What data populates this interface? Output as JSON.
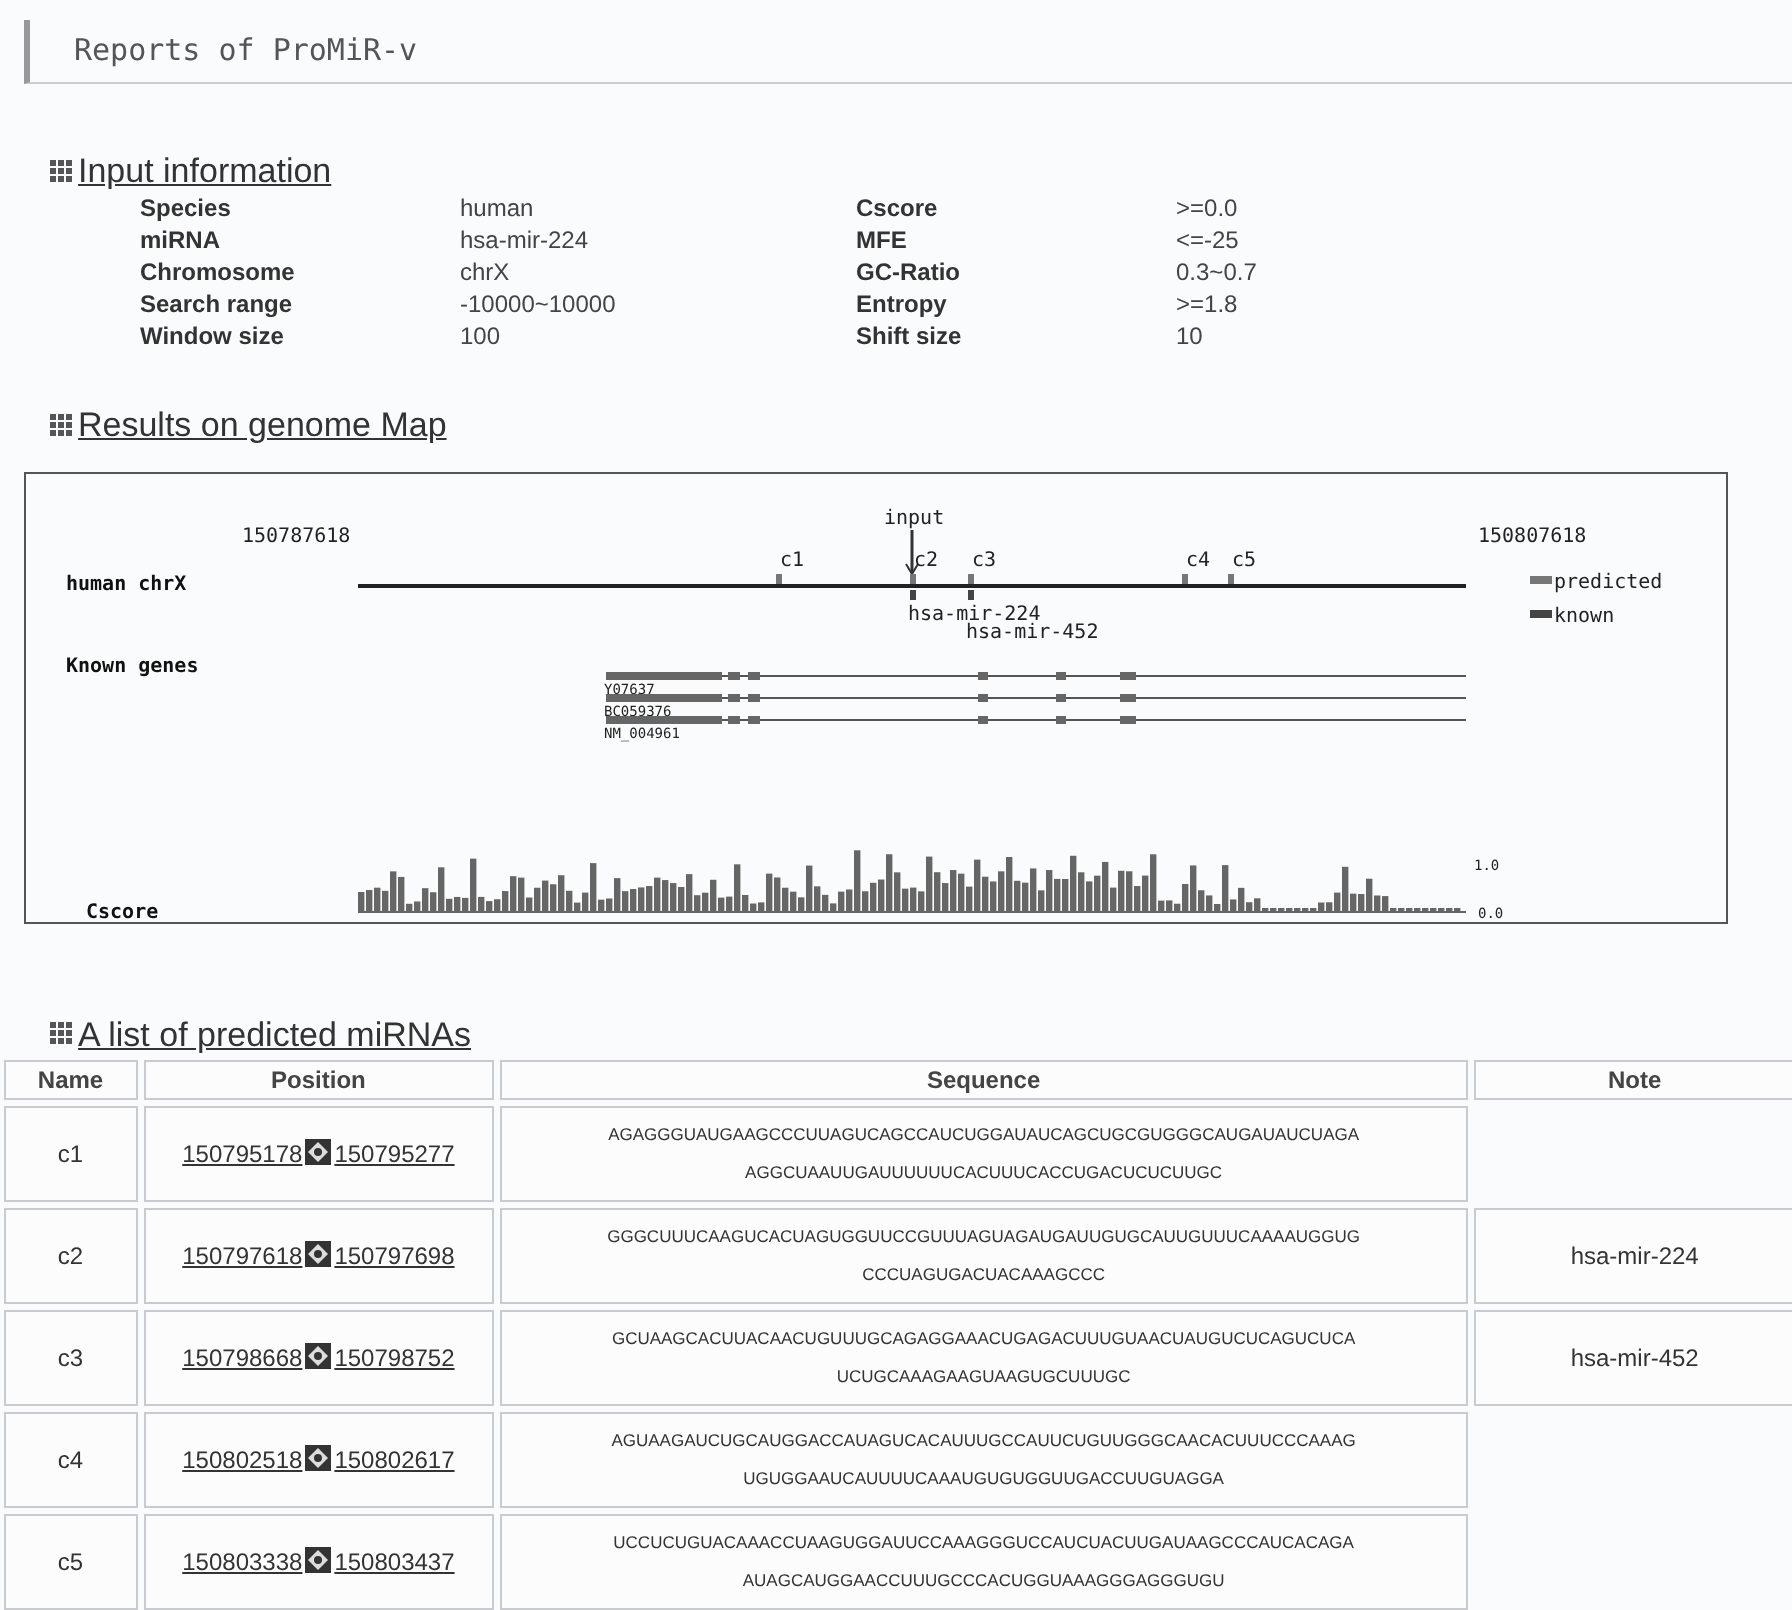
{
  "title": "Reports of ProMiR-v",
  "input_information": {
    "heading": "Input information",
    "left": [
      {
        "label": "Species",
        "value": "human"
      },
      {
        "label": "miRNA",
        "value": "hsa-mir-224"
      },
      {
        "label": "Chromosome",
        "value": "chrX"
      },
      {
        "label": "Search range",
        "value": "-10000~10000"
      },
      {
        "label": "Window size",
        "value": "100"
      }
    ],
    "right": [
      {
        "label": "Cscore",
        "value": ">=0.0"
      },
      {
        "label": "MFE",
        "value": "<=-25"
      },
      {
        "label": "GC-Ratio",
        "value": "0.3~0.7"
      },
      {
        "label": "Entropy",
        "value": ">=1.8"
      },
      {
        "label": "Shift size",
        "value": "10"
      }
    ]
  },
  "genome_map": {
    "heading": "Results on genome Map",
    "start": "150787618",
    "end": "150807618",
    "track_label": "human chrX",
    "input_label": "input",
    "predicted": [
      "c1",
      "c2",
      "c3",
      "c4",
      "c5"
    ],
    "known": [
      "hsa-mir-224",
      "hsa-mir-452"
    ],
    "legend": [
      "predicted",
      "known"
    ],
    "genes_label": "Known genes",
    "genes": [
      "Y07637",
      "BC059376",
      "NM_004961"
    ],
    "cscore_label": "Cscore",
    "cscore_max": "1.0",
    "cscore_min": "0.0"
  },
  "predicted_list": {
    "heading": "A list of predicted miRNAs",
    "columns": [
      "Name",
      "Position",
      "Sequence",
      "Note"
    ],
    "rows": [
      {
        "name": "c1",
        "start": "150795178",
        "end": "150795277",
        "sequence": [
          "AGAGGGUAUGAAGCCCUUAGUCAGCCAUCUGGAUAUCAGCUGCGUGGGCAUGAUAUCUAGA",
          "AGGCUAAUUGAUUUUUUCACUUUCACCUGACUCUCUUGC"
        ]
      },
      {
        "name": "c2",
        "start": "150797618",
        "end": "150797698",
        "sequence": [
          "GGGCUUUCAAGUCACUAGUGGUUCCGUUUAGUAGAUGAUUGUGCAUUGUUUCAAAAUGGUG",
          "CCCUAGUGACUACAAAGCCC"
        ],
        "note": "hsa-mir-224"
      },
      {
        "name": "c3",
        "start": "150798668",
        "end": "150798752",
        "sequence": [
          "GCUAAGCACUUACAACUGUUUGCAGAGGAAACUGAGACUUUGUAACUAUGUCUCAGUCUCA",
          "UCUGCAAAGAAGUAAGUGCUUUGC"
        ],
        "note": "hsa-mir-452"
      },
      {
        "name": "c4",
        "start": "150802518",
        "end": "150802617",
        "sequence": [
          "AGUAAGAUCUGCAUGGACCAUAGUCACAUUUGCCAUUCUGUUGGGCAACACUUUCCCAAAG",
          "UGUGGAAUCAUUUUCAAAUGUGUGGUUGACCUUGUAGGA"
        ]
      },
      {
        "name": "c5",
        "start": "150803338",
        "end": "150803437",
        "sequence": [
          "UCCUCUGUACAAACCUAAGUGGAUUCCAAAGGGUCCAUCUACUUGAUAAGCCCAUCACAGA",
          "AUAGCAUGGAACCUUUGCCCACUGGUAAAGGGAGGGUGU"
        ]
      }
    ]
  }
}
